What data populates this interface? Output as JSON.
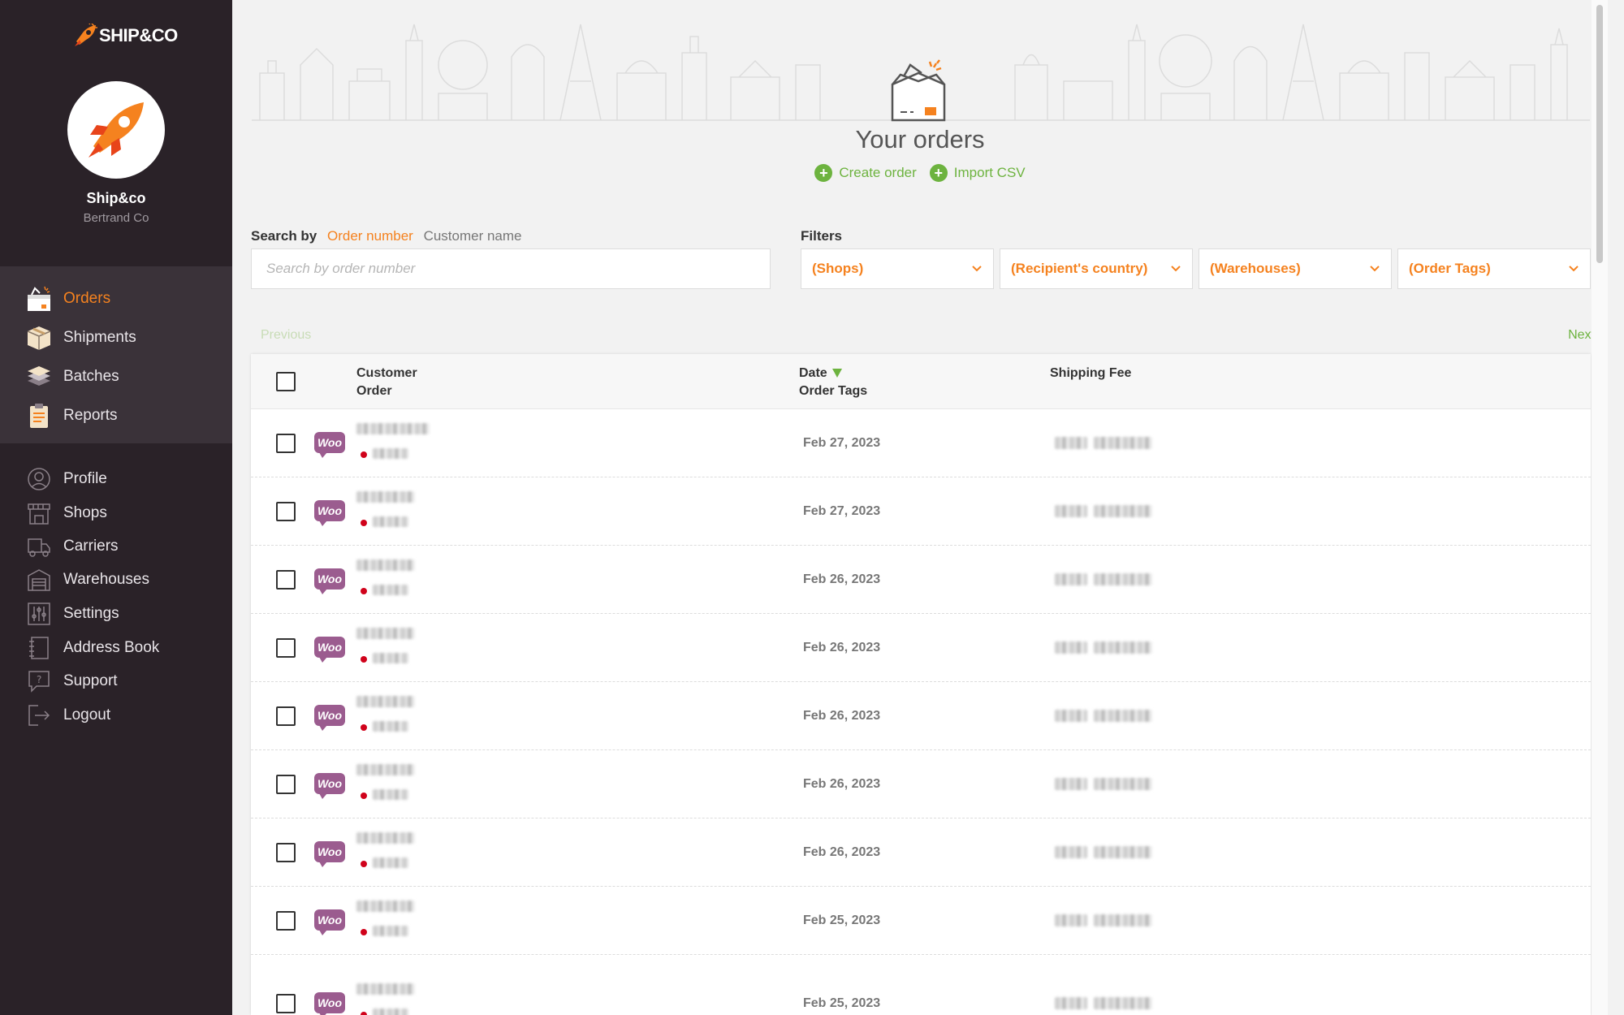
{
  "brand": {
    "logo_text": "SHIP&CO",
    "accent": "#f5821f",
    "green": "#6db33f",
    "sidebar_bg": "#2a2228"
  },
  "account": {
    "name": "Ship&co",
    "subtitle": "Bertrand Co"
  },
  "nav_main": [
    {
      "label": "Orders",
      "icon": "orders-box-icon",
      "active": true
    },
    {
      "label": "Shipments",
      "icon": "shipment-box-icon",
      "active": false
    },
    {
      "label": "Batches",
      "icon": "batches-stack-icon",
      "active": false
    },
    {
      "label": "Reports",
      "icon": "clipboard-icon",
      "active": false
    }
  ],
  "nav_secondary": [
    {
      "label": "Profile",
      "icon": "user-icon"
    },
    {
      "label": "Shops",
      "icon": "shop-icon"
    },
    {
      "label": "Carriers",
      "icon": "truck-icon"
    },
    {
      "label": "Warehouses",
      "icon": "warehouse-icon"
    },
    {
      "label": "Settings",
      "icon": "sliders-icon"
    },
    {
      "label": "Address Book",
      "icon": "address-book-icon"
    },
    {
      "label": "Support",
      "icon": "support-icon"
    },
    {
      "label": "Logout",
      "icon": "logout-icon"
    }
  ],
  "hero": {
    "title": "Your orders",
    "create_label": "Create order",
    "import_label": "Import CSV"
  },
  "search": {
    "label": "Search by",
    "option_active": "Order number",
    "option_inactive": "Customer name",
    "placeholder": "Search by order number",
    "value": ""
  },
  "filters": {
    "label": "Filters",
    "shops": "(Shops)",
    "country": "(Recipient's country)",
    "warehouses": "(Warehouses)",
    "tags": "(Order Tags)"
  },
  "pagination": {
    "previous": "Previous",
    "next": "Next"
  },
  "table": {
    "col_customer": "Customer",
    "col_order": "Order",
    "col_date": "Date",
    "col_tags": "Order Tags",
    "col_fee": "Shipping Fee",
    "rows": [
      {
        "shop": "Woo",
        "date": "Feb 27, 2023"
      },
      {
        "shop": "Woo",
        "date": "Feb 27, 2023"
      },
      {
        "shop": "Woo",
        "date": "Feb 26, 2023"
      },
      {
        "shop": "Woo",
        "date": "Feb 26, 2023"
      },
      {
        "shop": "Woo",
        "date": "Feb 26, 2023"
      },
      {
        "shop": "Woo",
        "date": "Feb 26, 2023"
      },
      {
        "shop": "Woo",
        "date": "Feb 26, 2023"
      },
      {
        "shop": "Woo",
        "date": "Feb 25, 2023"
      },
      {
        "shop": "Woo",
        "date": "Feb 25, 2023"
      }
    ]
  }
}
